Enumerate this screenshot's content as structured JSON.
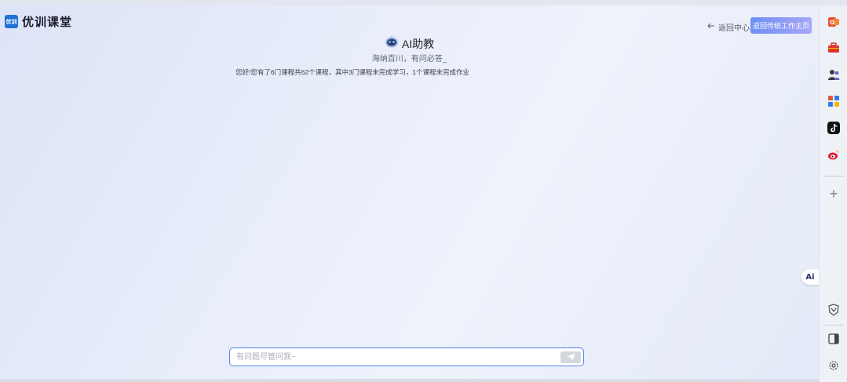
{
  "logo": {
    "badge": "优训",
    "name": "优训课堂"
  },
  "header": {
    "back_label": "返回中心",
    "action_button": "返回传统工作主页"
  },
  "assistant": {
    "title": "AI助教",
    "subtitle": "海纳百川，有问必答_",
    "message": "您好!您有了6门课程共62个课程，其中3门课程未完成学习，1个课程未完成作业"
  },
  "chat": {
    "placeholder": "有问题尽管问我~"
  },
  "sidebar": {
    "icons": [
      "office-icon",
      "briefcase-icon",
      "people-icon",
      "apps-icon",
      "tiktok-icon",
      "weibo-icon",
      "add-icon",
      "brand-icon",
      "panel-icon",
      "settings-icon"
    ],
    "add_label": "+"
  },
  "float": {
    "label": "Ai"
  },
  "colors": {
    "accent": "#4f84e8",
    "logo": "#1f6fd9",
    "button_start": "#6d8ff5",
    "button_end": "#a8a7f6"
  }
}
